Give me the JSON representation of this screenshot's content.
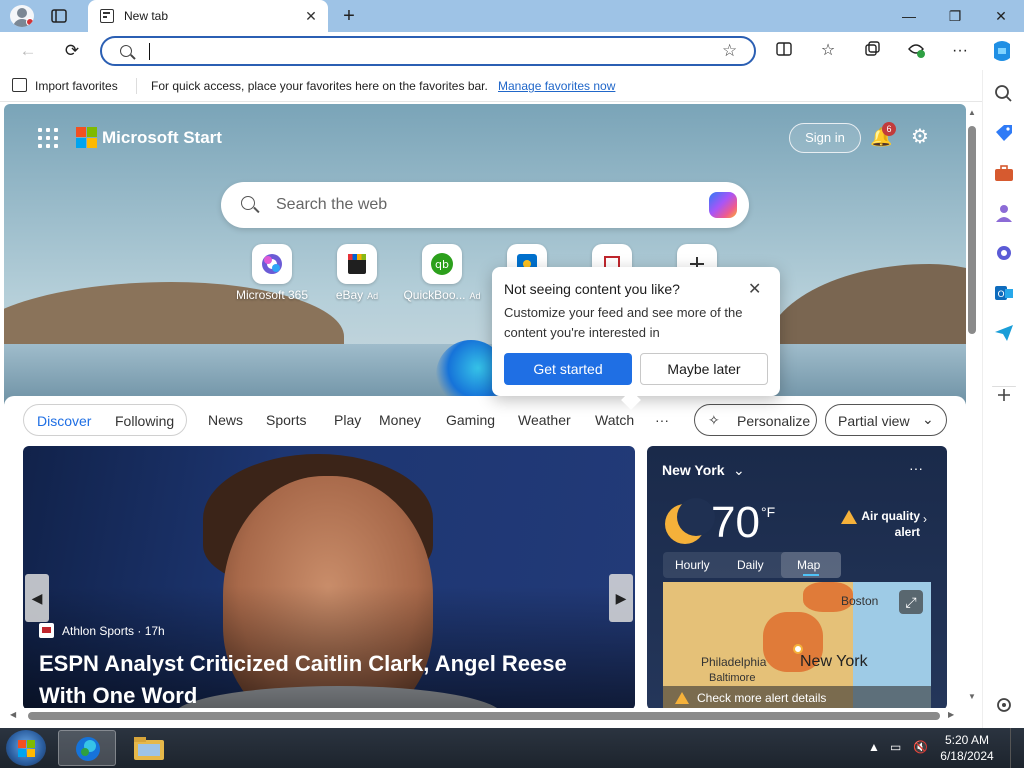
{
  "browser": {
    "tab_title": "New tab",
    "tab_close": "✕",
    "new_tab": "+",
    "window_controls": {
      "minimize": "—",
      "restore": "❐",
      "close": "✕"
    }
  },
  "toolbar": {
    "back": "←",
    "refresh": "⟳",
    "address_value": "",
    "favorite_star": "☆",
    "more": "···"
  },
  "favorites_bar": {
    "import_label": "Import favorites",
    "message": "For quick access, place your favorites here on the favorites bar.",
    "link": "Manage favorites now"
  },
  "page": {
    "brand": "Microsoft Start",
    "sign_in": "Sign in",
    "notification_count": "6",
    "search_placeholder": "Search the web",
    "quick_links": [
      {
        "label": "Microsoft 365",
        "ad": ""
      },
      {
        "label": "eBay",
        "ad": "Ad"
      },
      {
        "label": "QuickBoo...",
        "ad": "Ad"
      }
    ],
    "popup": {
      "title": "Not seeing content you like?",
      "body": "Customize your feed and see more of the content you're interested in",
      "primary": "Get started",
      "secondary": "Maybe later",
      "close": "✕"
    },
    "feed_toggle": {
      "discover": "Discover",
      "following": "Following"
    },
    "feed_nav": [
      "News",
      "Sports",
      "Play",
      "Money",
      "Gaming",
      "Weather",
      "Watch",
      "···"
    ],
    "personalize": "Personalize",
    "partial_view": "Partial view",
    "hero": {
      "source": "Athlon Sports · 17h",
      "headline": "ESPN Analyst Criticized Caitlin Clark, Angel Reese With One Word"
    },
    "weather": {
      "city": "New York",
      "temp": "70",
      "unit": "°F",
      "air_quality": "Air quality alert",
      "tabs": [
        "Hourly",
        "Daily",
        "Map"
      ],
      "map_labels": {
        "boston": "Boston",
        "philadelphia": "Philadelphia",
        "baltimore": "Baltimore",
        "new_york": "New York"
      },
      "alert": "Check more alert details"
    }
  },
  "taskbar": {
    "time": "5:20 AM",
    "date": "6/18/2024"
  },
  "colors": {
    "accent": "#1f6fe4",
    "titlebar": "#9ec3e6",
    "address_border": "#2b5fb3"
  }
}
